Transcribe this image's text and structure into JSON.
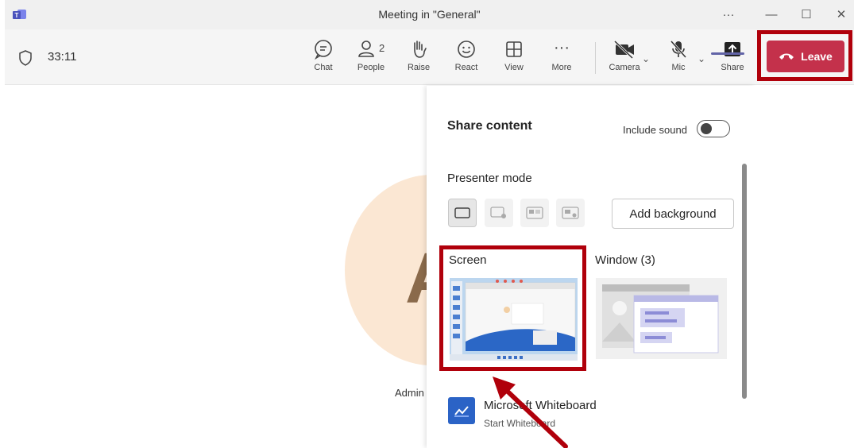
{
  "window": {
    "title": "Meeting in \"General\"",
    "more_glyph": "···",
    "minimize_glyph": "—",
    "maximize_glyph": "☐",
    "close_glyph": "✕"
  },
  "toolbar": {
    "timer": "33:11",
    "people_count": "2",
    "items": [
      {
        "label": "Chat",
        "icon": "chat-icon"
      },
      {
        "label": "People",
        "icon": "people-icon"
      },
      {
        "label": "Raise",
        "icon": "raise-hand-icon"
      },
      {
        "label": "React",
        "icon": "smiley-icon"
      },
      {
        "label": "View",
        "icon": "grid-icon"
      },
      {
        "label": "More",
        "icon": "more-icon"
      },
      {
        "label": "Camera",
        "icon": "camera-off-icon"
      },
      {
        "label": "Mic",
        "icon": "mic-off-icon"
      },
      {
        "label": "Share",
        "icon": "share-icon"
      }
    ],
    "leave_label": "Leave",
    "more_dots": "···",
    "chevron": "⌄"
  },
  "stage": {
    "avatar_initial": "A",
    "participant_name": "Admin"
  },
  "share_panel": {
    "title": "Share content",
    "include_sound_label": "Include sound",
    "presenter_mode_label": "Presenter mode",
    "add_background_label": "Add background",
    "screen_label": "Screen",
    "window_label": "Window (3)",
    "whiteboard_title": "Microsoft Whiteboard",
    "whiteboard_subtitle": "Start Whiteboard"
  },
  "colors": {
    "leave_red": "#c4314b",
    "highlight_red": "#b0000b",
    "teams_purple": "#6264a7"
  }
}
